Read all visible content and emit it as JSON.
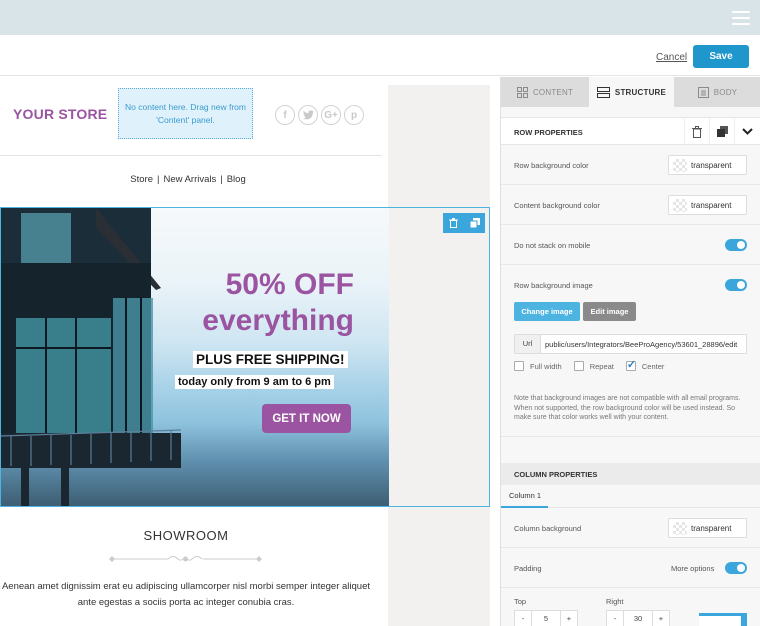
{
  "header": {
    "menu_icon": "hamburger-menu-icon",
    "cancel_label": "Cancel",
    "save_label": "Save"
  },
  "email": {
    "store_logo": "YOUR STORE",
    "dropzone_text": "No content here. Drag new from 'Content' panel.",
    "social_icons": [
      "facebook-icon",
      "twitter-icon",
      "google-plus-icon",
      "pinterest-icon"
    ],
    "social_glyphs": [
      "f",
      "t",
      "G+",
      "p"
    ],
    "nav": [
      "Store",
      "New Arrivals",
      "Blog"
    ],
    "nav_separator": "|",
    "hero": {
      "headline_line1": "50% OFF",
      "headline_line2": "everything",
      "subheadline": "PLUS FREE SHIPPING!",
      "hours": "today only from 9 am to 6 pm",
      "cta_label": "GET IT NOW"
    },
    "showroom_title": "SHOWROOM",
    "showroom_body": "Aenean amet dignissim erat eu adipiscing ullamcorper nisl morbi semper integer aliquet ante egestas a sociis porta ac integer conubia cras."
  },
  "panel": {
    "tabs": [
      {
        "label": "CONTENT",
        "icon": "grid-icon",
        "active": false
      },
      {
        "label": "STRUCTURE",
        "icon": "rows-icon",
        "active": true
      },
      {
        "label": "BODY",
        "icon": "page-icon",
        "active": false
      }
    ],
    "row_properties": {
      "title": "ROW PROPERTIES",
      "row_bg_color_label": "Row background color",
      "row_bg_color_value": "transparent",
      "content_bg_color_label": "Content background color",
      "content_bg_color_value": "transparent",
      "no_stack_label": "Do not stack on mobile",
      "no_stack_on": true,
      "row_bg_image_label": "Row background image",
      "row_bg_image_on": true,
      "change_image_label": "Change image",
      "edit_image_label": "Edit image",
      "url_label": "Url",
      "url_value": "public/users/Integrators/BeeProAgency/53601_28896/edit",
      "checkboxes": [
        {
          "label": "Full width",
          "checked": false
        },
        {
          "label": "Repeat",
          "checked": false
        },
        {
          "label": "Center",
          "checked": true
        }
      ],
      "note": "Note that background images are not compatible with all email programs. When not supported, the row background color will be used instead. So make sure that color works well with your content."
    },
    "column_properties": {
      "title": "COLUMN PROPERTIES",
      "tab_label": "Column 1",
      "column_bg_label": "Column background",
      "column_bg_value": "transparent",
      "padding_label": "Padding",
      "more_options_label": "More options",
      "more_options_on": true,
      "top_label": "Top",
      "top_value": "5",
      "right_label": "Right",
      "right_value": "30",
      "minus": "-",
      "plus": "+"
    }
  },
  "colors": {
    "brand_purple": "#9a54a1",
    "accent_blue": "#1f96cc",
    "toggle_blue": "#3aa6dc"
  }
}
